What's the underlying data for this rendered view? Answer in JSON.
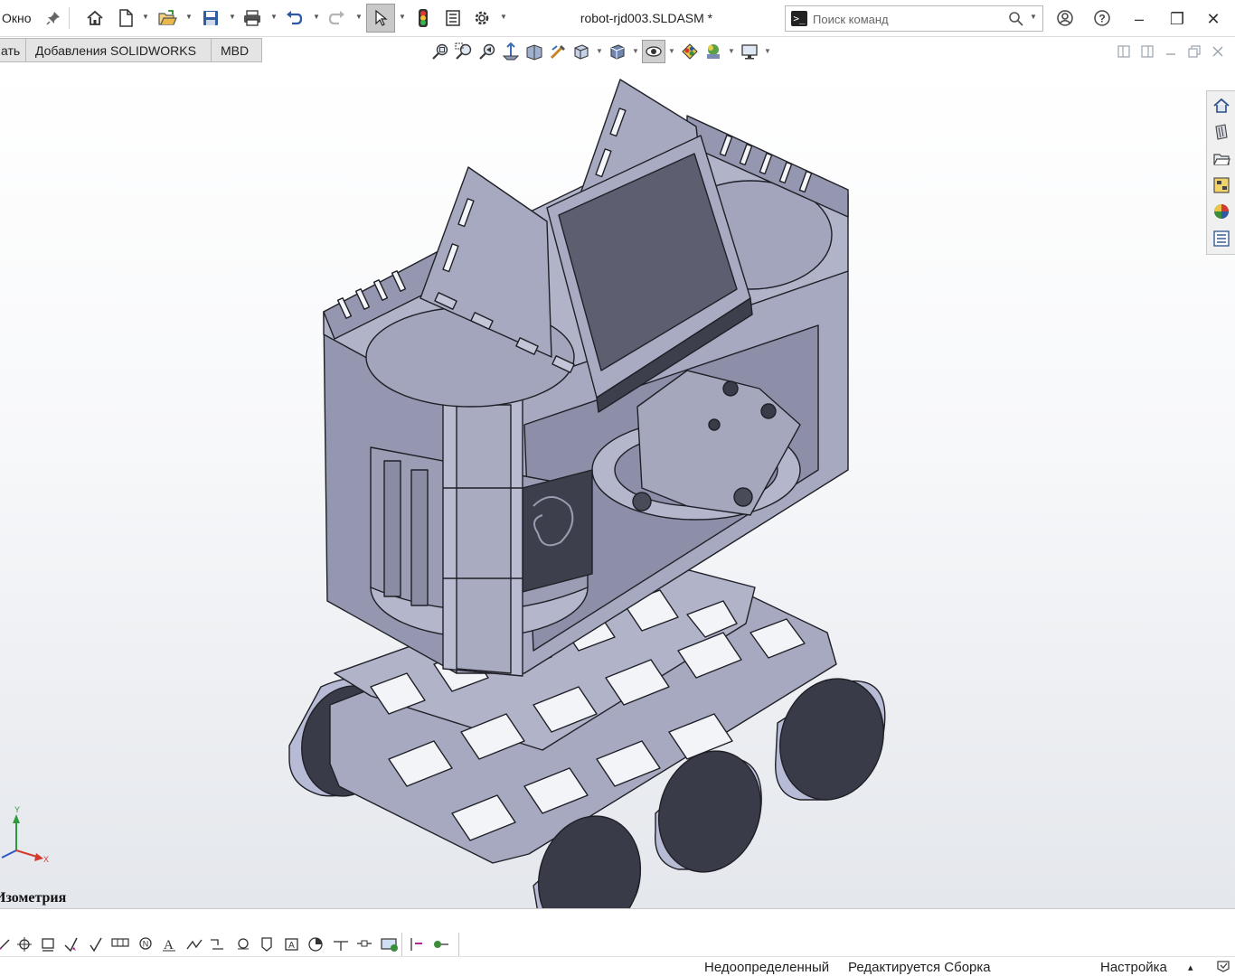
{
  "titlebar": {
    "menu_window": "Окно",
    "document_title": "robot-rjd003.SLDASM *",
    "search": {
      "placeholder": "Поиск команд"
    },
    "icons": [
      "pin-icon",
      "home-icon",
      "new-document-icon",
      "open-icon",
      "save-icon",
      "print-icon",
      "undo-icon",
      "redo-icon",
      "select-icon",
      "rebuild-icon",
      "file-properties-icon",
      "options-icon",
      "user-icon",
      "help-icon"
    ],
    "window_controls": {
      "minimize": "–",
      "restore": "❐",
      "close": "✕"
    }
  },
  "ribbon": {
    "tabs": [
      {
        "label": "ать"
      },
      {
        "label": "Добавления SOLIDWORKS"
      },
      {
        "label": "MBD"
      }
    ]
  },
  "heads_up_toolbar": {
    "icons": [
      "zoom-to-fit-icon",
      "zoom-to-area-icon",
      "previous-view-icon",
      "section-view-icon",
      "dynamic-annotation-icon",
      "view-orientation-icon",
      "display-style-icon",
      "hide-show-items-icon",
      "edit-appearance-icon",
      "apply-scene-icon",
      "view-settings-icon",
      "display-icon"
    ]
  },
  "viewport": {
    "view_label": "Изометрия",
    "triad": {
      "x": "X",
      "y": "Y"
    }
  },
  "task_pane": {
    "icons": [
      "solidworks-resources-icon",
      "design-library-icon",
      "file-explorer-icon",
      "view-palette-icon",
      "appearances-icon",
      "custom-properties-icon"
    ]
  },
  "status_bar": {
    "definition_state": "Недоопределенный",
    "edit_state": "Редактируется Сборка",
    "custom_label": "Настройка",
    "custom_arrow": "▴"
  },
  "colors": {
    "model_fill": "#a7a9c0",
    "model_dark": "#3e3f4d",
    "model_edge": "#1f2027",
    "wheel_side": "#b8bbd6",
    "wheel_face": "#3a3b48",
    "tab_bg": "#e4e4e4"
  }
}
